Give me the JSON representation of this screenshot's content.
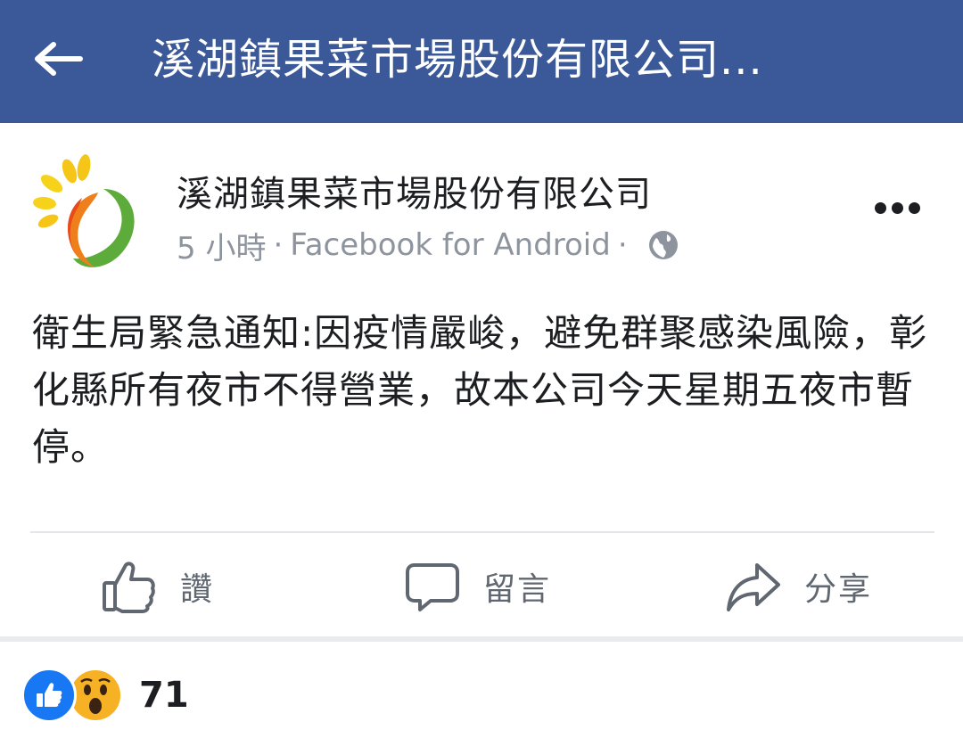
{
  "header": {
    "title": "溪湖鎮果菜市場股份有限公司..."
  },
  "post": {
    "page_name": "溪湖鎮果菜市場股份有限公司",
    "time": "5 小時",
    "separator": "·",
    "source": "Facebook for Android",
    "privacy_icon": "globe-icon",
    "text": "衛生局緊急通知:因疫情嚴峻，避免群聚感染風險，彰化縣所有夜市不得營業，故本公司今天星期五夜市暫停。"
  },
  "actions": {
    "like_label": "讚",
    "comment_label": "留言",
    "share_label": "分享"
  },
  "reactions": {
    "types": [
      "like",
      "wow"
    ],
    "count": "71"
  },
  "colors": {
    "header_bg": "#3b5998",
    "like_blue": "#1877f2",
    "wow_yellow": "#f7b125",
    "meta_gray": "#8d949e"
  }
}
